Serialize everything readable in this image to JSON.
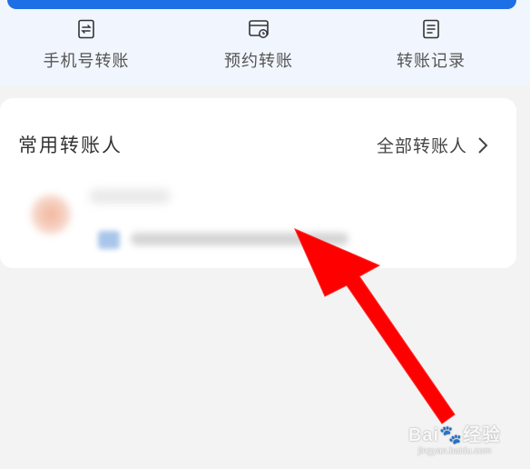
{
  "quick_actions": [
    {
      "label": "手机号转账",
      "icon": "phone-transfer-icon"
    },
    {
      "label": "预约转账",
      "icon": "scheduled-transfer-icon"
    },
    {
      "label": "转账记录",
      "icon": "transfer-records-icon"
    }
  ],
  "frequent_payees": {
    "title": "常用转账人",
    "view_all": "全部转账人"
  },
  "colors": {
    "brand_blue": "#1d6fe6",
    "panel_bg": "#f1f6fe",
    "page_bg": "#f3f3f3",
    "arrow_red": "#ff0000"
  },
  "watermark": {
    "brand": "Bai",
    "brand_cn": "经验",
    "url": "jingyan.baidu.com"
  }
}
